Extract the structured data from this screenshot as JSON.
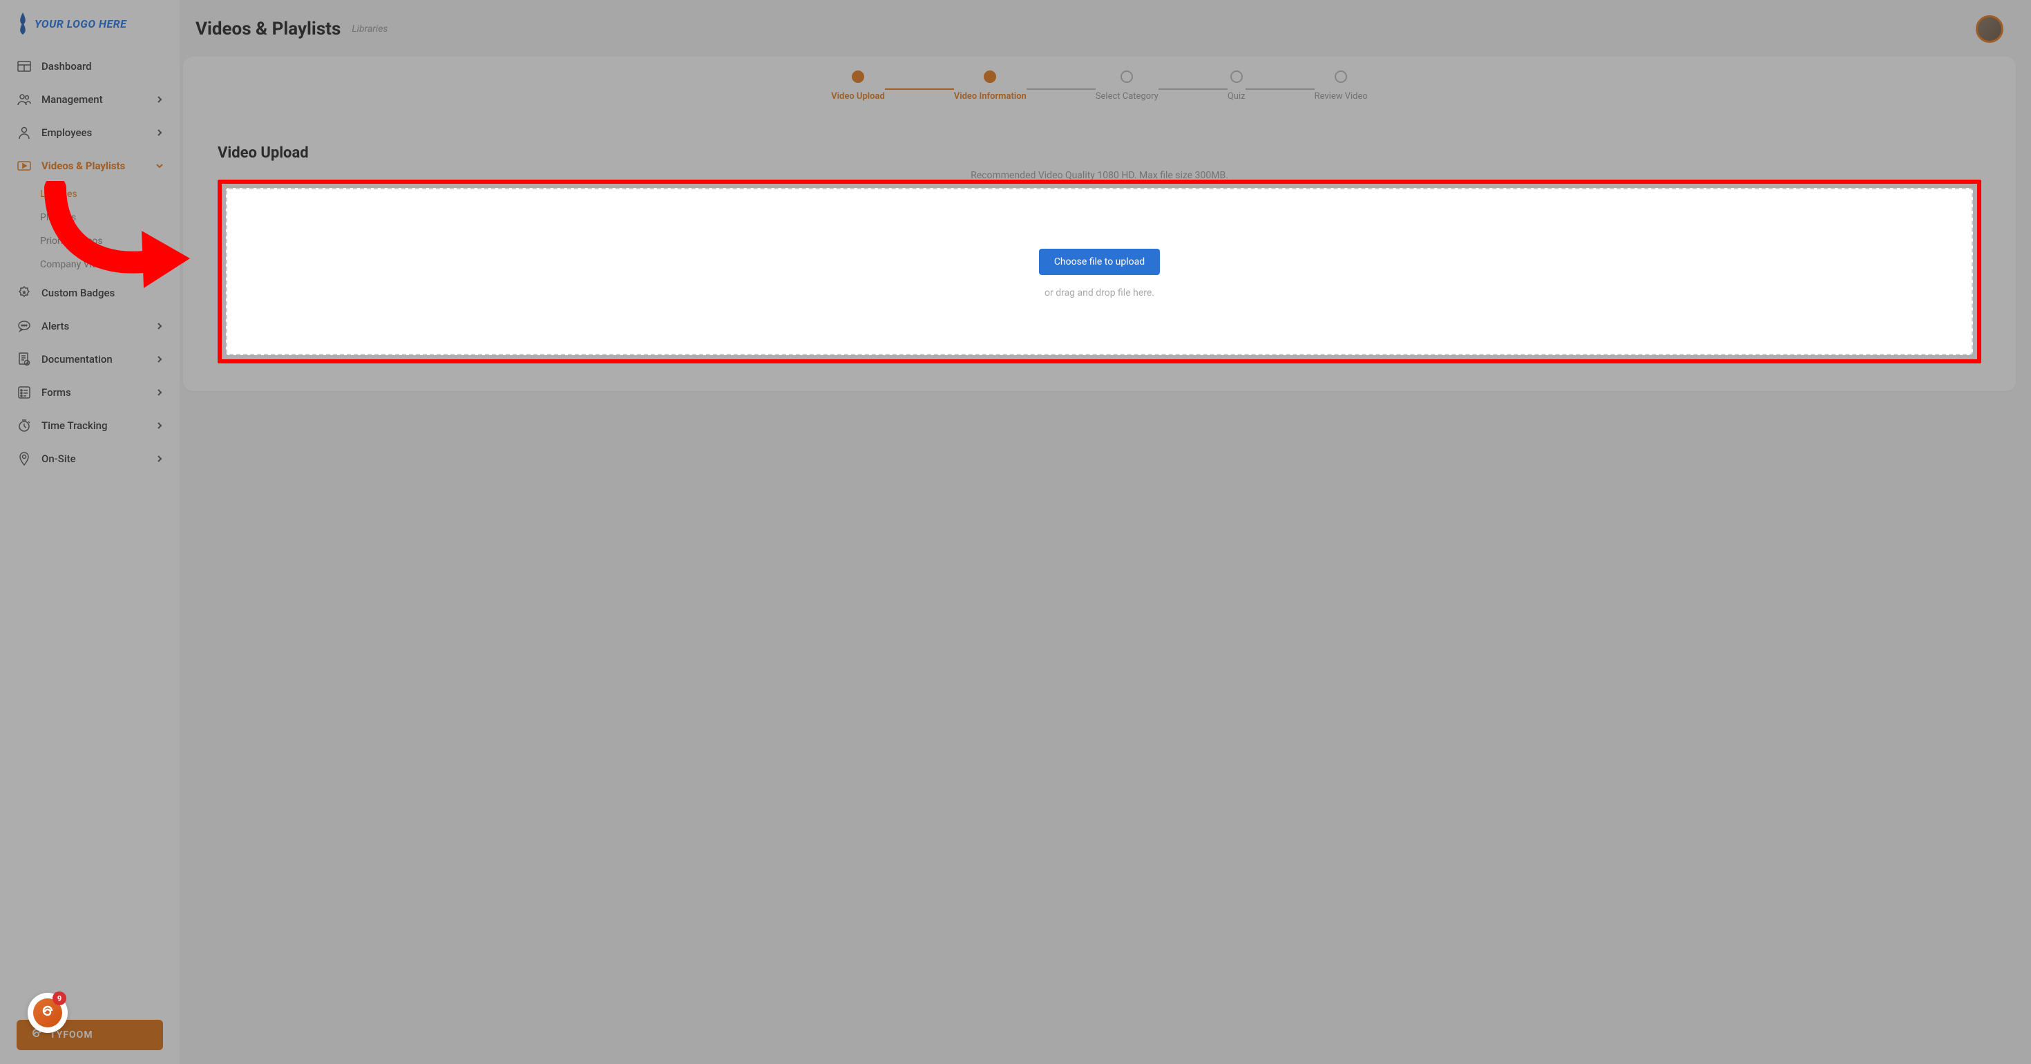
{
  "logo_text": "YOUR LOGO HERE",
  "page_title": "Videos & Playlists",
  "breadcrumb": "Libraries",
  "sidebar": {
    "items": [
      {
        "label": "Dashboard",
        "icon": "dashboard",
        "expandable": false
      },
      {
        "label": "Management",
        "icon": "people",
        "expandable": true
      },
      {
        "label": "Employees",
        "icon": "person",
        "expandable": true
      },
      {
        "label": "Videos & Playlists",
        "icon": "video",
        "expandable": true,
        "active": true,
        "children": [
          {
            "label": "Libraries",
            "active": true
          },
          {
            "label": "Playlists"
          },
          {
            "label": "Priority Videos"
          },
          {
            "label": "Company Video Library"
          }
        ]
      },
      {
        "label": "Custom Badges",
        "icon": "badge",
        "expandable": false
      },
      {
        "label": "Alerts",
        "icon": "alert",
        "expandable": true
      },
      {
        "label": "Documentation",
        "icon": "doc",
        "expandable": true
      },
      {
        "label": "Forms",
        "icon": "form",
        "expandable": true
      },
      {
        "label": "Time Tracking",
        "icon": "clock",
        "expandable": true
      },
      {
        "label": "On-Site",
        "icon": "location",
        "expandable": true
      }
    ],
    "footer_label": "TYFOOM",
    "badge_count": "9"
  },
  "stepper": [
    {
      "label": "Video Upload",
      "state": "done"
    },
    {
      "label": "Video Information",
      "state": "current"
    },
    {
      "label": "Select Category",
      "state": "pending"
    },
    {
      "label": "Quiz",
      "state": "pending"
    },
    {
      "label": "Review Video",
      "state": "pending"
    }
  ],
  "panel": {
    "title": "Video Upload",
    "hint": "Recommended Video Quality 1080 HD. Max file size 300MB.",
    "upload_button": "Choose file to upload",
    "dropzone_hint": "or drag and drop file here."
  }
}
